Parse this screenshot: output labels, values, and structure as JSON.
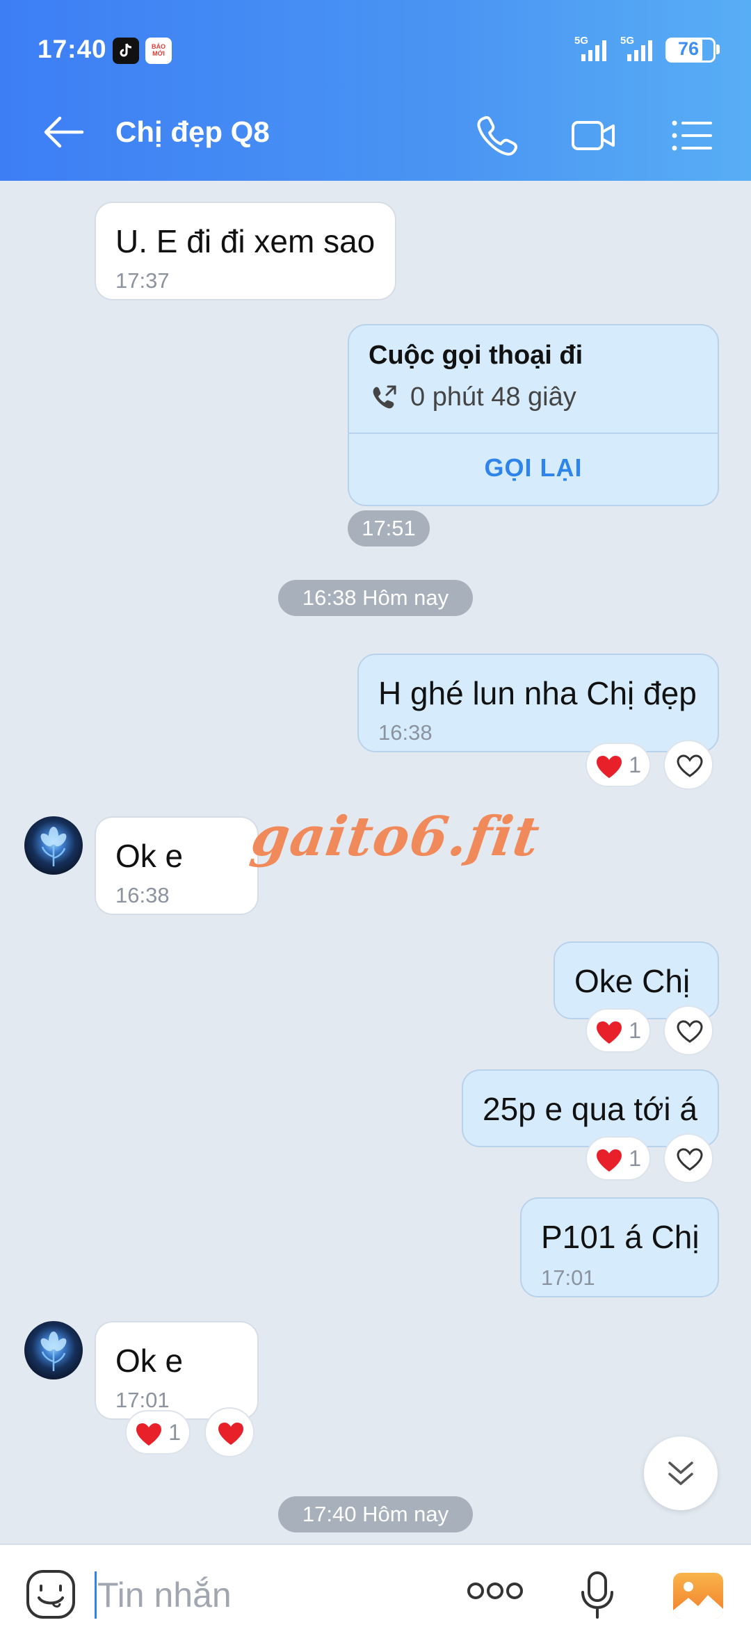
{
  "status_bar": {
    "time": "17:40",
    "app_icons": [
      "tiktok-icon",
      "baomoi-icon"
    ],
    "baomoi_label": "BÁO MỚI",
    "signal_1": "5G",
    "signal_2": "5G",
    "battery": "76",
    "battery_level": 0.76
  },
  "header": {
    "title": "Chị đẹp Q8",
    "icons": [
      "back-arrow-icon",
      "phone-icon",
      "video-camera-icon",
      "menu-list-icon"
    ]
  },
  "messages": [
    {
      "direction": "incoming",
      "text": "U. E đi đi xem sao",
      "time": "17:37"
    },
    {
      "direction": "outgoing",
      "type": "call",
      "title": "Cuộc gọi thoại đi",
      "duration": "0 phút 48 giây",
      "action": "GỌI LẠI",
      "time": "17:51"
    },
    {
      "type": "date_separator",
      "text": "16:38 Hôm nay"
    },
    {
      "direction": "outgoing",
      "text": "H ghé lun nha Chị đẹp",
      "time": "16:38",
      "reaction_count": "1"
    },
    {
      "direction": "incoming",
      "text": "Ok e",
      "time": "16:38"
    },
    {
      "direction": "outgoing",
      "text": "Oke Chị",
      "reaction_count": "1"
    },
    {
      "direction": "outgoing",
      "text": "25p e qua tới á",
      "reaction_count": "1"
    },
    {
      "direction": "outgoing",
      "text": "P101 á Chị",
      "time": "17:01"
    },
    {
      "direction": "incoming",
      "text": "Ok e",
      "time": "17:01",
      "reaction_count": "1"
    },
    {
      "type": "date_separator",
      "text": "17:40 Hôm nay"
    }
  ],
  "watermark": "gaito6.fit",
  "composer": {
    "placeholder": "Tin nhắn",
    "icons": [
      "emoji-icon",
      "more-dots-icon",
      "microphone-icon",
      "image-gallery-icon"
    ]
  },
  "colors": {
    "header_start": "#3d7ef5",
    "header_end": "#58aef5",
    "outgoing_bubble": "#d6ebfc",
    "incoming_bubble": "#ffffff",
    "chat_background": "#e2e9f1",
    "accent": "#2e84ea",
    "reaction_red": "#e8202a",
    "watermark": "#f08a5a"
  }
}
